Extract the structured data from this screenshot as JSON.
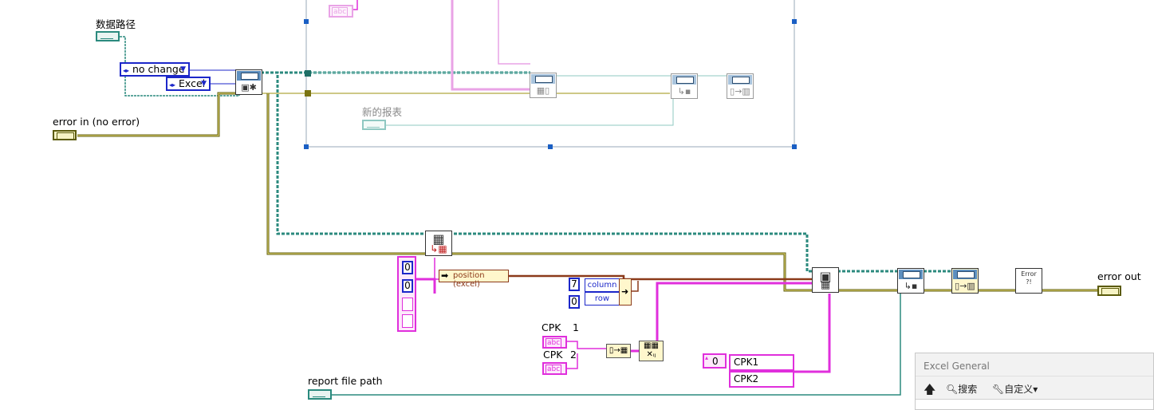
{
  "labels": {
    "data_path": "数据路径",
    "error_in": "error in (no error)",
    "new_report": "新的报表",
    "cpk_top": "CPK",
    "error_out": "error out",
    "report_file_path": "report file path",
    "cpk1_label": "CPK",
    "cpk1_index": "1",
    "cpk2_label": "CPK",
    "cpk2_index": "2"
  },
  "controls": {
    "ring_no_change": "no change",
    "ring_excel": "Excel",
    "position_excel": "position (excel)",
    "column_label": "column",
    "row_label": "row",
    "column_value": "7",
    "row_value": "0",
    "array_values": [
      "0",
      "0"
    ],
    "string_array_index": "0",
    "string_array_items": [
      "CPK1",
      "CPK2"
    ],
    "abc_glyph": "abc"
  },
  "icons": {
    "error_dialog": "Error ?!"
  },
  "panel": {
    "title": "Excel General",
    "search": "搜索",
    "customize": "自定义▾"
  },
  "colors": {
    "path_wire": "#2b8a7e",
    "error_wire": "#5b5b0c",
    "string_wire": "#e02fdc",
    "cluster_wire": "#8b3a1a",
    "numeric_blue": "#1c27c9",
    "selection_handle": "#1a5fc4"
  }
}
